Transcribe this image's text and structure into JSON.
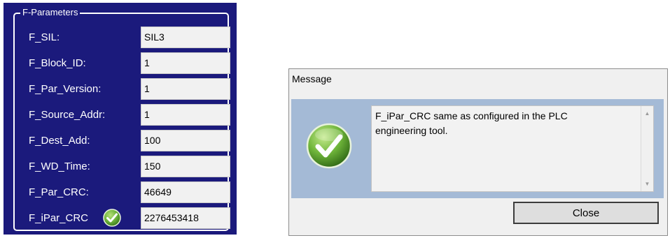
{
  "fparameters": {
    "group_title": "F-Parameters",
    "rows": [
      {
        "label": "F_SIL:",
        "value": "SIL3"
      },
      {
        "label": "F_Block_ID:",
        "value": "1"
      },
      {
        "label": "F_Par_Version:",
        "value": "1"
      },
      {
        "label": "F_Source_Addr:",
        "value": "1"
      },
      {
        "label": "F_Dest_Add:",
        "value": "100"
      },
      {
        "label": "F_WD_Time:",
        "value": "150"
      },
      {
        "label": "F_Par_CRC:",
        "value": "46649"
      },
      {
        "label": "F_iPar_CRC",
        "value": "2276453418",
        "icon": "checkmark-icon"
      }
    ]
  },
  "message_dialog": {
    "title": "Message",
    "icon": "checkmark-icon",
    "text_line1": "F_iPar_CRC same as configured in the PLC",
    "text_line2": "engineering tool.",
    "close_label": "Close"
  },
  "colors": {
    "panel_bg": "#1b1a7c",
    "dialog_body_bg": "#a4bad6",
    "check_green": "#5aa02c"
  }
}
